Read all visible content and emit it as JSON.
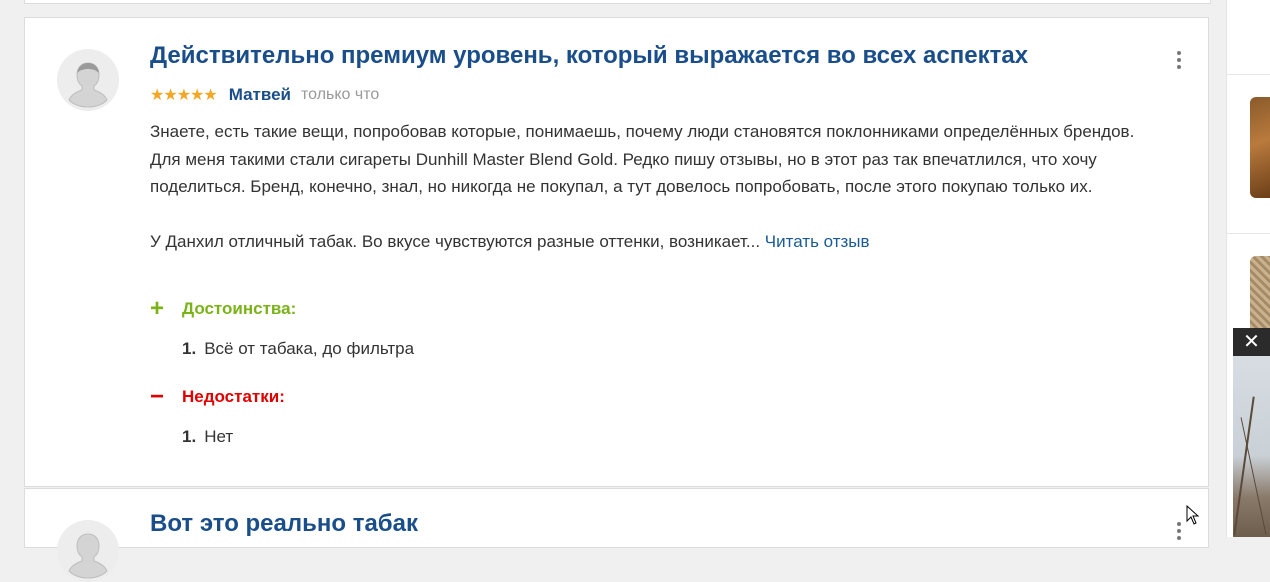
{
  "review": {
    "title": "Действительно премиум уровень, который выражается во всех аспектах",
    "stars": "★★★★★",
    "rating": 5,
    "author": "Матвей",
    "time": "только что",
    "paragraph1": "Знаете, есть такие вещи, попробовав которые, понимаешь, почему люди становятся поклонниками определённых брендов. Для меня такими стали сигареты Dunhill Master Blend Gold. Редко пишу отзывы, но в этот раз так впечатлился, что хочу поделиться. Бренд, конечно, знал, но никогда не покупал, а тут довелось попробовать, после этого покупаю только их.",
    "paragraph2": "У Данхил отличный табак. Во вкусе чувствуются разные оттенки, возникает...",
    "read_more": "Читать отзыв",
    "pros": {
      "sign": "+",
      "label": "Достоинства:",
      "items": [
        {
          "num": "1.",
          "text": "Всё от табака, до фильтра"
        }
      ]
    },
    "cons": {
      "sign": "−",
      "label": "Недостатки:",
      "items": [
        {
          "num": "1.",
          "text": "Нет"
        }
      ]
    }
  },
  "review2": {
    "title": "Вот это реально табак"
  },
  "ad": {
    "close_glyph": "✕"
  },
  "colors": {
    "title": "#1a4e8a",
    "stars": "#f5a623",
    "pros": "#7ab317",
    "cons": "#e00000",
    "link": "#1a5a96"
  }
}
